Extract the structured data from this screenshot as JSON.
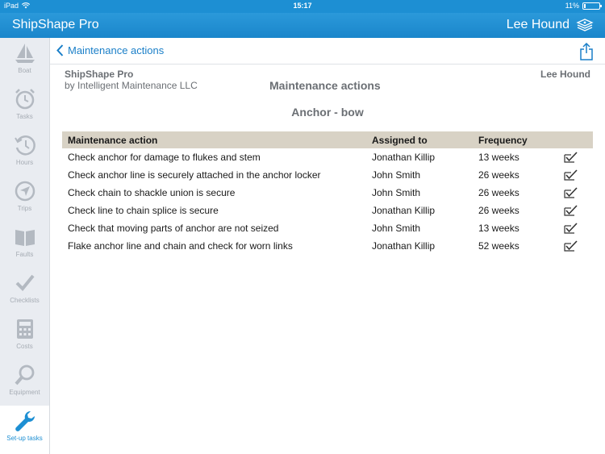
{
  "status": {
    "device": "iPad",
    "time": "15:17",
    "battery": "11%",
    "battery_fraction": 0.11
  },
  "navbar": {
    "app_title": "ShipShape Pro",
    "user_name": "Lee Hound"
  },
  "sidebar": {
    "items": [
      {
        "label": "Boat",
        "icon": "sailboat-icon"
      },
      {
        "label": "Tasks",
        "icon": "alarm-clock-icon"
      },
      {
        "label": "Hours",
        "icon": "history-clock-icon"
      },
      {
        "label": "Trips",
        "icon": "compass-arrow-icon"
      },
      {
        "label": "Faults",
        "icon": "open-book-icon"
      },
      {
        "label": "Checklists",
        "icon": "checkmark-icon"
      },
      {
        "label": "Costs",
        "icon": "calculator-icon"
      },
      {
        "label": "Equipment",
        "icon": "magnifier-icon"
      },
      {
        "label": "Set-up tasks",
        "icon": "wrench-icon",
        "active": true
      }
    ]
  },
  "subnav": {
    "back_label": "Maintenance actions"
  },
  "report": {
    "company_name": "ShipShape Pro",
    "company_by": "by Intelligent Maintenance LLC",
    "title": "Maintenance actions",
    "user": "Lee Hound",
    "subtitle": "Anchor - bow"
  },
  "table": {
    "headers": [
      "Maintenance action",
      "Assigned to",
      "Frequency",
      ""
    ],
    "rows": [
      {
        "action": "Check anchor for damage to flukes and stem",
        "assigned": "Jonathan Killip",
        "frequency": "13 weeks"
      },
      {
        "action": "Check anchor line is securely attached in the anchor locker",
        "assigned": "John Smith",
        "frequency": "26 weeks"
      },
      {
        "action": "Check chain to shackle union is secure",
        "assigned": "John Smith",
        "frequency": "26 weeks"
      },
      {
        "action": "Check line to chain splice is secure",
        "assigned": "Jonathan Killip",
        "frequency": "26 weeks"
      },
      {
        "action": "Check that moving parts of anchor are not seized",
        "assigned": "John Smith",
        "frequency": "13 weeks"
      },
      {
        "action": "Flake anchor line and chain and check for worn links",
        "assigned": "Jonathan Killip",
        "frequency": "52 weeks"
      }
    ]
  },
  "colors": {
    "accent": "#1d8fd3",
    "header_row": "#d8d2c5",
    "sidebar_bg": "#e9ecf1"
  }
}
